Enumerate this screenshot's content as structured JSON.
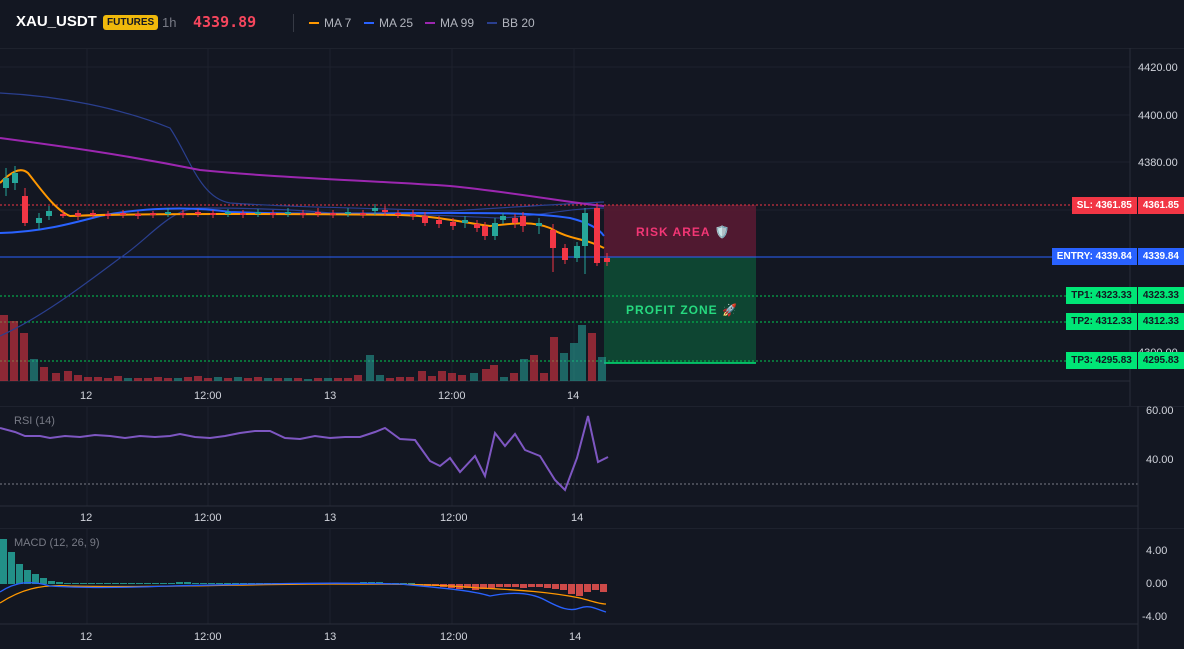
{
  "header": {
    "symbol": "XAU_USDT",
    "badge": "FUTURES",
    "interval": "1h",
    "price": "4339.89",
    "legend": [
      {
        "label": "MA 7",
        "color": "#ff9800"
      },
      {
        "label": "MA 25",
        "color": "#2962ff"
      },
      {
        "label": "MA 99",
        "color": "#9c27b0"
      },
      {
        "label": "BB 20",
        "color": "#2a3f8f"
      }
    ]
  },
  "main_axis": {
    "ticks": [
      "4420.00",
      "4400.00",
      "4380.00",
      "4300.00"
    ]
  },
  "time_axis": [
    "12",
    "12:00",
    "13",
    "12:00",
    "14"
  ],
  "levels": {
    "sl": {
      "label": "SL: 4361.85",
      "price": "4361.85",
      "value": 4361.85
    },
    "entry": {
      "label": "ENTRY: 4339.84",
      "price": "4339.84",
      "value": 4339.84
    },
    "tp1": {
      "label": "TP1: 4323.33",
      "price": "4323.33",
      "value": 4323.33
    },
    "tp2": {
      "label": "TP2: 4312.33",
      "price": "4312.33",
      "value": 4312.33
    },
    "tp3": {
      "label": "TP3: 4295.83",
      "price": "4295.83",
      "value": 4295.83
    }
  },
  "zones": {
    "risk": "RISK AREA 🛡️",
    "profit": "PROFIT ZONE 🚀"
  },
  "rsi": {
    "title": "RSI (14)",
    "ticks": [
      "60.00",
      "40.00"
    ]
  },
  "macd": {
    "title": "MACD (12, 26, 9)",
    "ticks": [
      "4.00",
      "0.00",
      "-4.00"
    ]
  },
  "colors": {
    "up": "#26a69a",
    "down": "#f23645",
    "bg": "#131722"
  }
}
